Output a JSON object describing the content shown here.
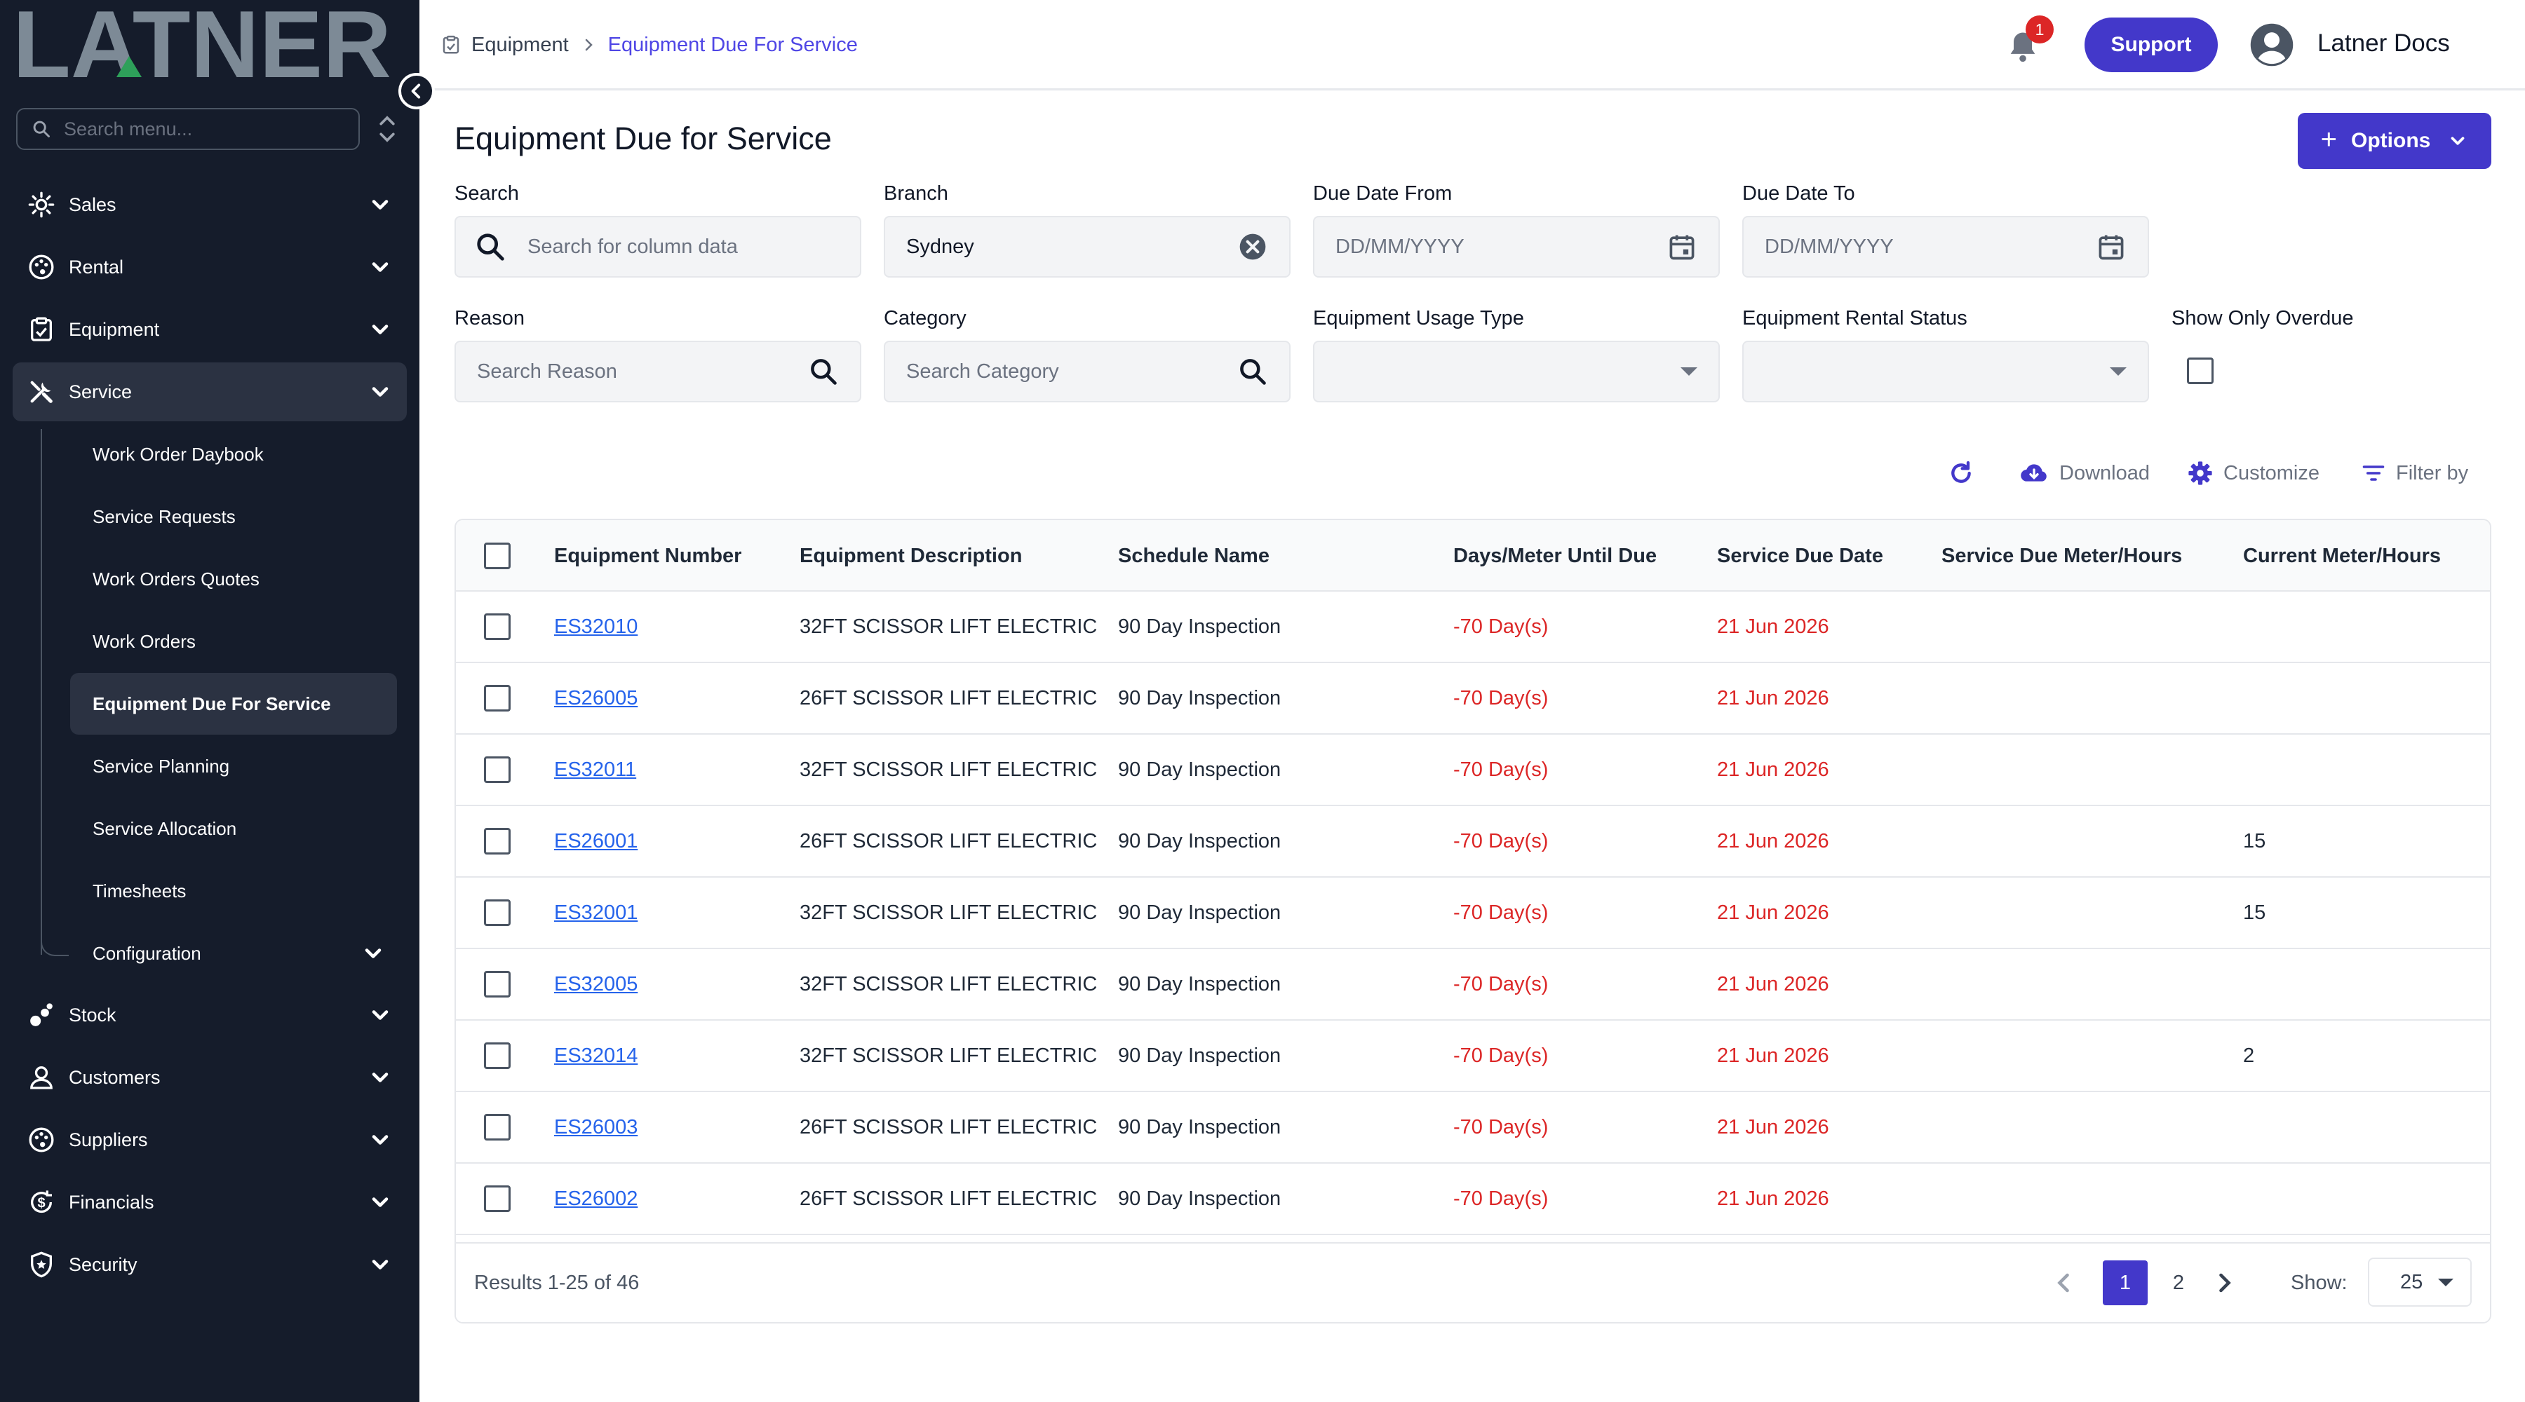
{
  "brand": {
    "logo_text": "LATNER"
  },
  "sidebar": {
    "search_placeholder": "Search menu...",
    "items": [
      {
        "label": "Sales",
        "icon": "sun-icon"
      },
      {
        "label": "Rental",
        "icon": "palette-icon"
      },
      {
        "label": "Equipment",
        "icon": "clipboard-icon"
      },
      {
        "label": "Service",
        "icon": "tools-icon"
      },
      {
        "label": "Stock",
        "icon": "boxes-icon"
      },
      {
        "label": "Customers",
        "icon": "person-icon"
      },
      {
        "label": "Suppliers",
        "icon": "palette-icon"
      },
      {
        "label": "Financials",
        "icon": "dollar-cycle-icon"
      },
      {
        "label": "Security",
        "icon": "shield-icon"
      }
    ],
    "service_subitems": [
      {
        "label": "Work Order Daybook"
      },
      {
        "label": "Service Requests"
      },
      {
        "label": "Work Orders Quotes"
      },
      {
        "label": "Work Orders"
      },
      {
        "label": "Equipment Due For Service"
      },
      {
        "label": "Service Planning"
      },
      {
        "label": "Service Allocation"
      },
      {
        "label": "Timesheets"
      },
      {
        "label": "Configuration"
      }
    ]
  },
  "header": {
    "breadcrumb": {
      "parent": "Equipment",
      "current": "Equipment Due For Service"
    },
    "notification_count": "1",
    "support_label": "Support",
    "user_name": "Latner Docs"
  },
  "page": {
    "title": "Equipment Due for Service",
    "options_label": "Options"
  },
  "filters": {
    "search": {
      "label": "Search",
      "placeholder": "Search for column data"
    },
    "branch": {
      "label": "Branch",
      "value": "Sydney"
    },
    "due_from": {
      "label": "Due Date From",
      "placeholder": "DD/MM/YYYY"
    },
    "due_to": {
      "label": "Due Date To",
      "placeholder": "DD/MM/YYYY"
    },
    "reason": {
      "label": "Reason",
      "placeholder": "Search Reason"
    },
    "category": {
      "label": "Category",
      "placeholder": "Search Category"
    },
    "usage_type": {
      "label": "Equipment Usage Type"
    },
    "rental_status": {
      "label": "Equipment Rental Status"
    },
    "overdue": {
      "label": "Show Only Overdue"
    }
  },
  "toolbar": {
    "download": "Download",
    "customize": "Customize",
    "filter_by": "Filter by"
  },
  "table": {
    "columns": [
      "Equipment Number",
      "Equipment Description",
      "Schedule Name",
      "Days/Meter Until Due",
      "Service Due Date",
      "Service Due Meter/Hours",
      "Current Meter/Hours"
    ],
    "rows": [
      {
        "number": "ES32010",
        "description": "32FT SCISSOR LIFT ELECTRIC",
        "schedule": "90 Day Inspection",
        "until_due": "-70 Day(s)",
        "due_date": "21 Jun 2026",
        "due_meter": "",
        "current_meter": ""
      },
      {
        "number": "ES26005",
        "description": "26FT SCISSOR LIFT ELECTRIC",
        "schedule": "90 Day Inspection",
        "until_due": "-70 Day(s)",
        "due_date": "21 Jun 2026",
        "due_meter": "",
        "current_meter": ""
      },
      {
        "number": "ES32011",
        "description": "32FT SCISSOR LIFT ELECTRIC",
        "schedule": "90 Day Inspection",
        "until_due": "-70 Day(s)",
        "due_date": "21 Jun 2026",
        "due_meter": "",
        "current_meter": ""
      },
      {
        "number": "ES26001",
        "description": "26FT SCISSOR LIFT ELECTRIC",
        "schedule": "90 Day Inspection",
        "until_due": "-70 Day(s)",
        "due_date": "21 Jun 2026",
        "due_meter": "",
        "current_meter": "15"
      },
      {
        "number": "ES32001",
        "description": "32FT SCISSOR LIFT ELECTRIC",
        "schedule": "90 Day Inspection",
        "until_due": "-70 Day(s)",
        "due_date": "21 Jun 2026",
        "due_meter": "",
        "current_meter": "15"
      },
      {
        "number": "ES32005",
        "description": "32FT SCISSOR LIFT ELECTRIC",
        "schedule": "90 Day Inspection",
        "until_due": "-70 Day(s)",
        "due_date": "21 Jun 2026",
        "due_meter": "",
        "current_meter": ""
      },
      {
        "number": "ES32014",
        "description": "32FT SCISSOR LIFT ELECTRIC",
        "schedule": "90 Day Inspection",
        "until_due": "-70 Day(s)",
        "due_date": "21 Jun 2026",
        "due_meter": "",
        "current_meter": "2"
      },
      {
        "number": "ES26003",
        "description": "26FT SCISSOR LIFT ELECTRIC",
        "schedule": "90 Day Inspection",
        "until_due": "-70 Day(s)",
        "due_date": "21 Jun 2026",
        "due_meter": "",
        "current_meter": ""
      },
      {
        "number": "ES26002",
        "description": "26FT SCISSOR LIFT ELECTRIC",
        "schedule": "90 Day Inspection",
        "until_due": "-70 Day(s)",
        "due_date": "21 Jun 2026",
        "due_meter": "",
        "current_meter": ""
      }
    ]
  },
  "pagination": {
    "results": "Results 1-25 of 46",
    "pages": [
      "1",
      "2"
    ],
    "current_page": "1",
    "show_label": "Show:",
    "page_size": "25"
  },
  "colors": {
    "sidebar_bg": "#151c2b",
    "accent": "#4338ca",
    "overdue_red": "#dc2626",
    "link_blue": "#2563eb",
    "logo_gray": "#7d8a96",
    "logo_green": "#2ea05a"
  }
}
